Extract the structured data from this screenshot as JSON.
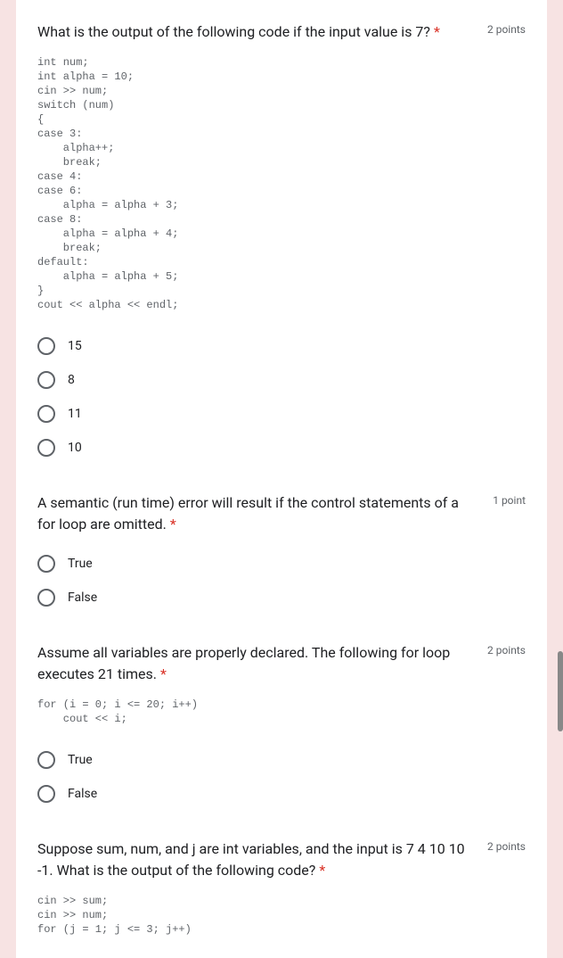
{
  "questions": [
    {
      "title": "What is the output of the following code if the input value is 7?",
      "points": "2 points",
      "code": "int num;\nint alpha = 10;\ncin >> num;\nswitch (num)\n{\ncase 3:\n    alpha++;\n    break;\ncase 4:\ncase 6:\n    alpha = alpha + 3;\ncase 8:\n    alpha = alpha + 4;\n    break;\ndefault:\n    alpha = alpha + 5;\n}\ncout << alpha << endl;",
      "options": [
        "15",
        "8",
        "11",
        "10"
      ]
    },
    {
      "title": "A semantic (run time) error will result if the control statements of a for loop are omitted.",
      "points": "1 point",
      "code": "",
      "options": [
        "True",
        "False"
      ]
    },
    {
      "title": "Assume all variables are properly declared. The following for loop executes 21 times.",
      "points": "2 points",
      "code": "for (i = 0; i <= 20; i++)\n    cout << i;",
      "options": [
        "True",
        "False"
      ]
    },
    {
      "title": "Suppose sum, num, and j are int variables, and the input is 7 4 10 10 -1. What is the output of the following code?",
      "points": "2 points",
      "code": "cin >> sum;\ncin >> num;\nfor (j = 1; j <= 3; j++)",
      "options": []
    }
  ],
  "asterisk": " *"
}
